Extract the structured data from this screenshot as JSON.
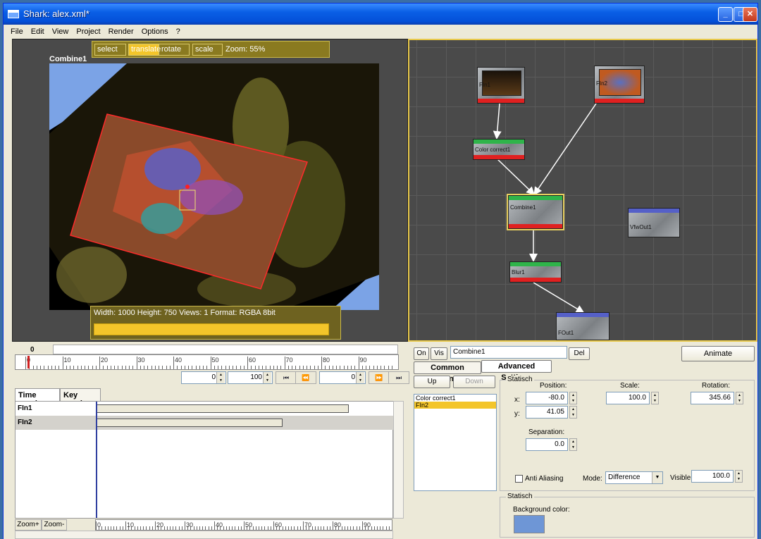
{
  "window": {
    "title": "Shark: alex.xml*"
  },
  "menu": [
    "File",
    "Edit",
    "View",
    "Project",
    "Render",
    "Options",
    "?"
  ],
  "viewer": {
    "tools": {
      "select": "select",
      "translate": "translate",
      "rotate": "rotate",
      "scale": "scale"
    },
    "zoom": "Zoom: 55%",
    "node_name": "Combine1",
    "info": "Width: 1000 Height: 750 Views: 1 Format: RGBA 8bit"
  },
  "graph": {
    "nodes": {
      "fin1": "FIn1",
      "fin2": "FIn2",
      "color_correct": "Color correct1",
      "combine": "Combine1",
      "vfwout": "VfwOut1",
      "blur": "Blur1",
      "fout": "FOut1"
    }
  },
  "timeline": {
    "current_frame": "0",
    "ruler_labels": [
      "0",
      "10",
      "20",
      "30",
      "40",
      "50",
      "60",
      "70",
      "80",
      "90"
    ],
    "start": "0",
    "end": "100",
    "cur": "0"
  },
  "tracks": {
    "tab_time": "Time graph",
    "tab_key": "Key graph",
    "rows": [
      {
        "name": "FIn1"
      },
      {
        "name": "FIn2"
      }
    ],
    "zoom_plus": "Zoom+",
    "zoom_minus": "Zoom-",
    "ruler_labels": [
      "0",
      "10",
      "20",
      "30",
      "40",
      "50",
      "60",
      "70",
      "80",
      "90"
    ]
  },
  "props": {
    "on": "On",
    "vis": "Vis",
    "name": "Combine1",
    "del": "Del",
    "animate": "Animate",
    "tab_common": "Common Settings",
    "tab_advanced": "Advanced Settings",
    "up": "Up",
    "down": "Down",
    "list": [
      "Color correct1",
      "FIn2"
    ],
    "group1_title": "Statisch",
    "position_label": "Position:",
    "x_label": "x:",
    "x": "-80.0",
    "y_label": "y:",
    "y": "41.05",
    "scale_label": "Scale:",
    "scale": "100.0",
    "rotation_label": "Rotation:",
    "rotation": "345.66",
    "separation_label": "Separation:",
    "separation": "0.0",
    "anti_aliasing": "Anti Aliasing",
    "mode_label": "Mode:",
    "mode": "Difference",
    "visible_label": "Visible:",
    "visible": "100.0",
    "group2_title": "Statisch",
    "bg_label": "Background color:",
    "bg_color": "#6e96d6"
  }
}
